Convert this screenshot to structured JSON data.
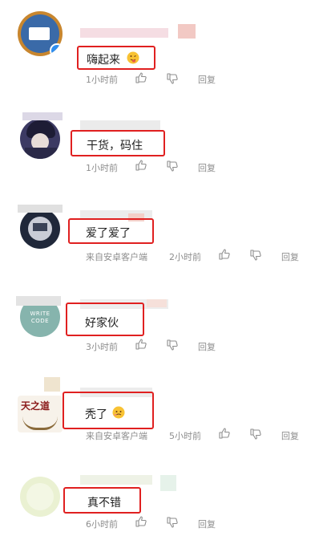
{
  "comments": [
    {
      "text": "嗨起来",
      "time": "1小时前",
      "source": "",
      "reply": "回复",
      "emoji": "tongue-face"
    },
    {
      "text": "干货，码住",
      "time": "1小时前",
      "source": "",
      "reply": "回复",
      "emoji": ""
    },
    {
      "text": "爱了爱了",
      "time": "2小时前",
      "source": "来自安卓客户端",
      "reply": "回复",
      "emoji": ""
    },
    {
      "text": "好家伙",
      "time": "3小时前",
      "source": "",
      "reply": "回复",
      "emoji": ""
    },
    {
      "text": "秃了",
      "time": "5小时前",
      "source": "来自安卓客户端",
      "reply": "回复",
      "emoji": "bald-face"
    },
    {
      "text": "真不错",
      "time": "6小时前",
      "source": "",
      "reply": "回复",
      "emoji": ""
    }
  ],
  "avatar_labels": {
    "avatar4_line1": "WRITE",
    "avatar4_line2": "CODE",
    "avatar5_text": "天之道"
  }
}
